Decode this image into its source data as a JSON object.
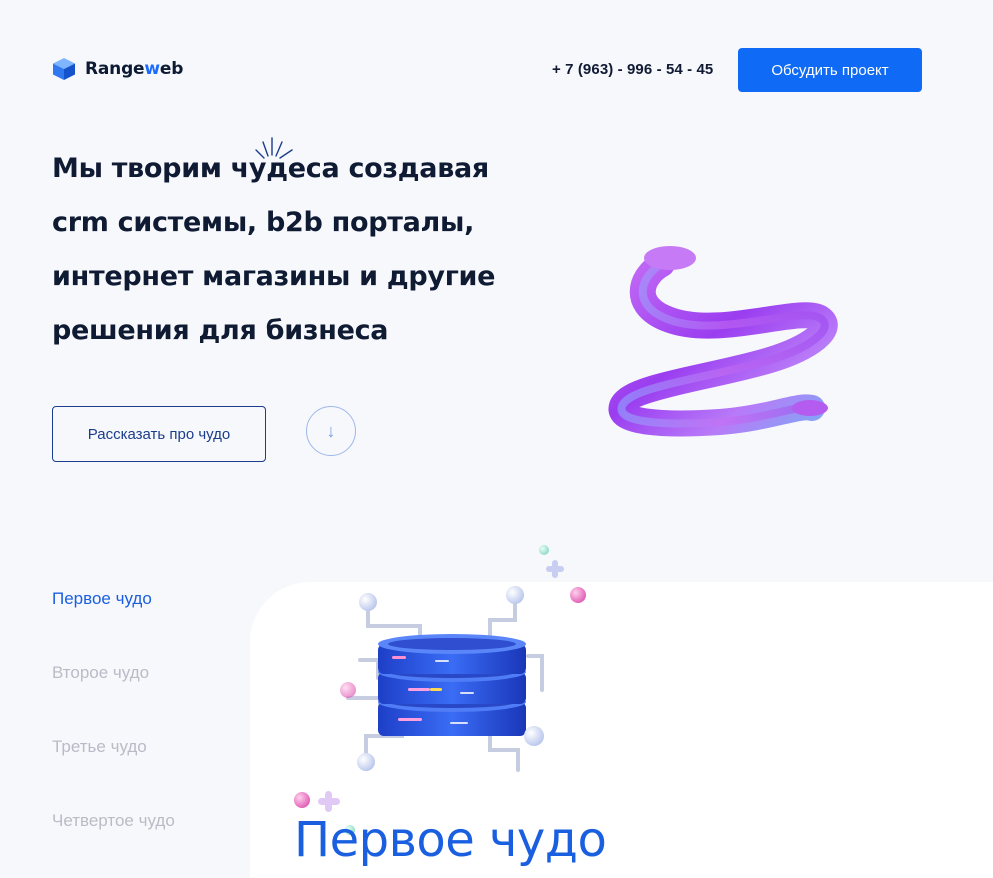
{
  "header": {
    "logo": {
      "prefix": "Range",
      "accent": "w",
      "suffix": "eb"
    },
    "phone": "+ 7 (963) - 996 - 54 - 45",
    "cta_label": "Обсудить проект"
  },
  "hero": {
    "title_lines": [
      "Мы творим чудеса создавая",
      "crm системы, b2b порталы,",
      "интернет магазины и другие",
      "решения для бизнеса"
    ],
    "primary_button": "Рассказать про чудо",
    "scroll_arrow": "↓"
  },
  "wonders": {
    "items": [
      {
        "label": "Первое чудо",
        "active": true
      },
      {
        "label": "Второе чудо",
        "active": false
      },
      {
        "label": "Третье чудо",
        "active": false
      },
      {
        "label": "Четвертое чудо",
        "active": false
      }
    ],
    "panel_title": "Первое чудо"
  },
  "colors": {
    "accent": "#0f6bf5",
    "heading": "#0f1a33",
    "active_nav": "#1a5fe0",
    "inactive_nav": "#b9bcc6",
    "background": "#f7f8fc"
  }
}
